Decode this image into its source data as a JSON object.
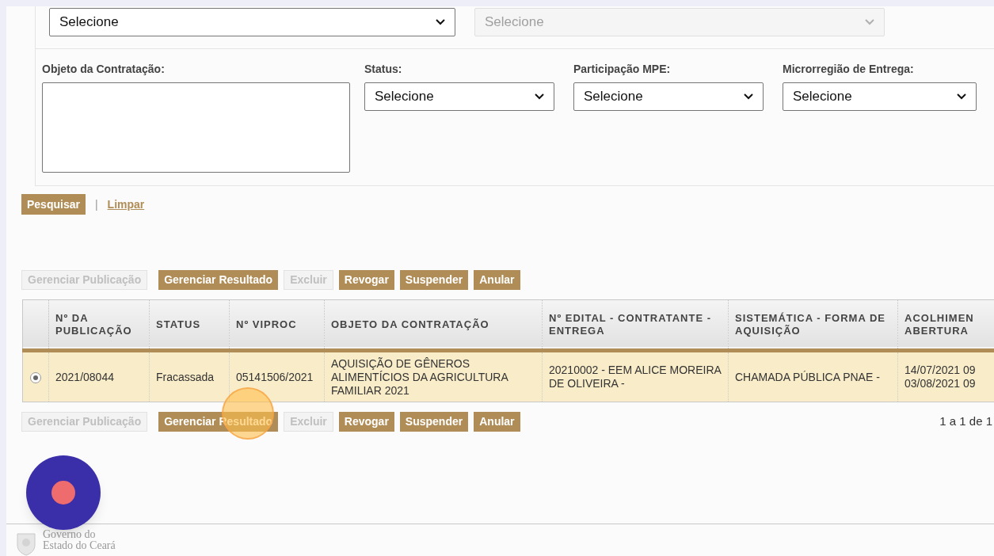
{
  "top_selects": [
    {
      "value": "Selecione",
      "disabled": false
    },
    {
      "value": "Selecione",
      "disabled": true
    }
  ],
  "filters": [
    {
      "label": "Objeto da Contratação:",
      "kind": "textarea"
    },
    {
      "label": "Status:",
      "kind": "select",
      "value": "Selecione"
    },
    {
      "label": "Participação MPE:",
      "kind": "select",
      "value": "Selecione"
    },
    {
      "label": "Microrregião de Entrega:",
      "kind": "select",
      "value": "Selecione"
    }
  ],
  "search_button": "Pesquisar",
  "separator": "|",
  "clear_link": "Limpar",
  "actions": [
    {
      "label": "Gerenciar Publicação",
      "disabled": true
    },
    {
      "label": "Gerenciar Resultado",
      "disabled": false
    },
    {
      "label": "Excluir",
      "disabled": true
    },
    {
      "label": "Revogar",
      "disabled": false
    },
    {
      "label": "Suspender",
      "disabled": false
    },
    {
      "label": "Anular",
      "disabled": false
    }
  ],
  "table": {
    "columns": [
      "Nº DA PUBLICAÇÃO",
      "STATUS",
      "Nº VIPROC",
      "OBJETO DA CONTRATAÇÃO",
      "Nº EDITAL - CONTRATANTE - ENTREGA",
      "SISTEMÁTICA - FORMA DE AQUISIÇÃO",
      "ACOLHIMEN ABERTURA"
    ],
    "rows": [
      {
        "selected": true,
        "cells": [
          "2021/08044",
          "Fracassada",
          "05141506/2021",
          "AQUISIÇÃO DE GÊNEROS ALIMENTÍCIOS DA AGRICULTURA FAMILIAR 2021",
          "20210002 - EEM ALICE MOREIRA DE OLIVEIRA -",
          "CHAMADA PÚBLICA PNAE -",
          "14/07/2021 09 03/08/2021 09"
        ]
      }
    ]
  },
  "bottom_actions": [
    {
      "label": "Gerenciar Publicação",
      "disabled": true
    },
    {
      "label": "Gerenciar Resultado",
      "disabled": false
    },
    {
      "label": "Excluir",
      "disabled": true
    },
    {
      "label": "Revogar",
      "disabled": false
    },
    {
      "label": "Suspender",
      "disabled": false
    },
    {
      "label": "Anular",
      "disabled": false
    }
  ],
  "pagination": "1 a 1 de 1",
  "footer": {
    "lines": [
      "Governo do",
      "Estado do Ceará"
    ]
  }
}
